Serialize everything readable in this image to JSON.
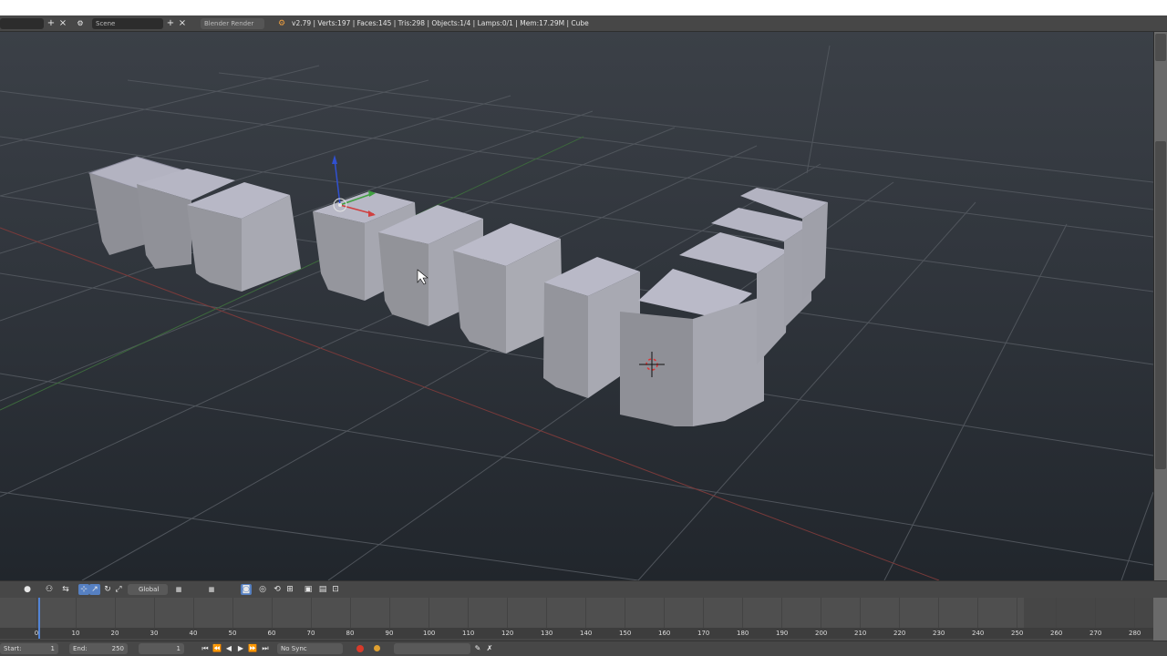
{
  "info_header": {
    "layout_field": "",
    "scene_field": "Scene",
    "render_engine": "Blender Render",
    "stats": "v2.79 | Verts:197 | Faces:145 | Tris:298 | Objects:1/4 | Lamps:0/1 | Mem:17.29M | Cube",
    "add_icon": "+",
    "close_icon": "×"
  },
  "view3d_header": {
    "pivot_label": "Global",
    "icons": [
      "view-menu-icon",
      "shading-solid-icon",
      "mode-icon",
      "manipulator-icon",
      "translate-icon",
      "rotate-icon",
      "scale-icon",
      "snap-icon",
      "layers-icon",
      "render-icon"
    ]
  },
  "timeline": {
    "ticks": [
      "0",
      "10",
      "20",
      "30",
      "40",
      "50",
      "60",
      "70",
      "80",
      "90",
      "100",
      "110",
      "120",
      "130",
      "140",
      "150",
      "160",
      "170",
      "180",
      "190",
      "200",
      "210",
      "220",
      "230",
      "240",
      "250",
      "260",
      "270",
      "280"
    ],
    "current_frame": 1
  },
  "timeline_header": {
    "start_label": "Start:",
    "start_value": "1",
    "end_label": "End:",
    "end_value": "250",
    "current_value": "1",
    "sync": "No Sync"
  },
  "colors": {
    "header_bg": "#474747",
    "viewport_top": "#3b4047",
    "viewport_bottom": "#21262c",
    "playhead": "#5284d6",
    "x_axis": "#d04040",
    "y_axis": "#3fa03f",
    "z_axis": "#3050d0",
    "cube_face": "#9a9ba2",
    "cube_top": "#b6b6c4"
  }
}
